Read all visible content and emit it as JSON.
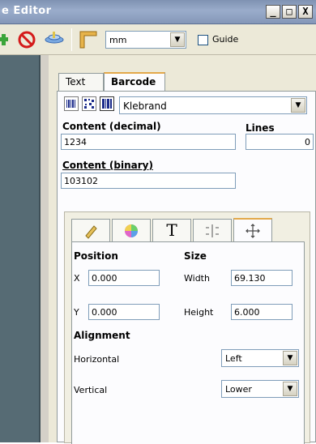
{
  "window": {
    "title": "e Editor",
    "controls": [
      "_",
      "□",
      "X"
    ]
  },
  "toolbar": {
    "unit_value": "mm",
    "guides_label": "Guide"
  },
  "tabs": {
    "text": "Text",
    "barcode": "Barcode"
  },
  "barcode": {
    "type_value": "Klebrand",
    "content_decimal_label": "Content (decimal)",
    "content_decimal_value": "1234",
    "lines_label": "Lines",
    "lines_value": "0",
    "content_binary_label": "Content (binary)",
    "content_binary_value": "103102"
  },
  "layout": {
    "tab_text_glyph": "T",
    "position_label": "Position",
    "size_label": "Size",
    "x_label": "X",
    "x_value": "0.000",
    "y_label": "Y",
    "y_value": "0.000",
    "width_label": "Width",
    "width_value": "69.130",
    "height_label": "Height",
    "height_value": "6.000",
    "alignment_label": "Alignment",
    "horizontal_label": "Horizontal",
    "horizontal_value": "Left",
    "vertical_label": "Vertical",
    "vertical_value": "Lower"
  }
}
